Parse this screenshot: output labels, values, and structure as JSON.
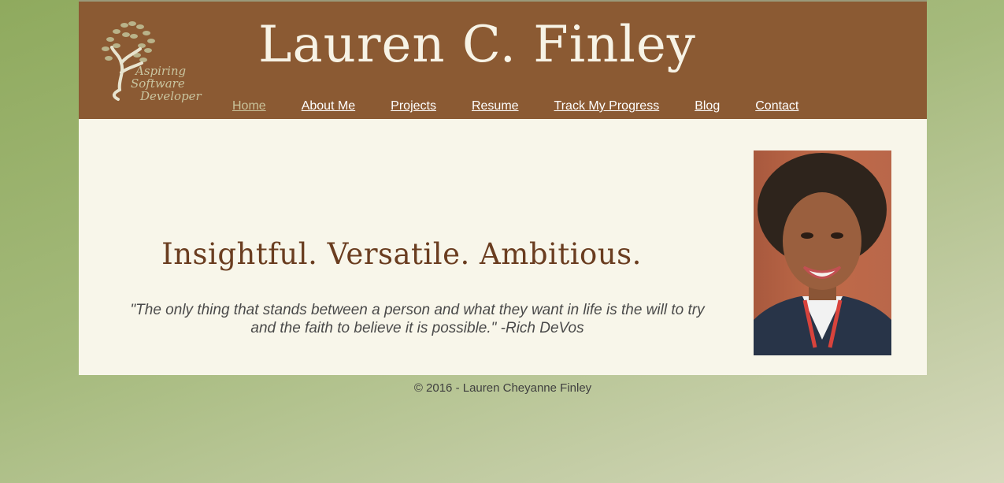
{
  "header": {
    "site_title": "Lauren C. Finley",
    "logo": {
      "line1": "Aspiring",
      "line2": "Software",
      "line3": "Developer",
      "icon": "tree-logo-icon"
    }
  },
  "nav": {
    "items": [
      {
        "label": "Home",
        "active": true
      },
      {
        "label": "About Me"
      },
      {
        "label": "Projects"
      },
      {
        "label": "Resume"
      },
      {
        "label": "Track My Progress"
      },
      {
        "label": "Blog"
      },
      {
        "label": "Contact"
      }
    ]
  },
  "main": {
    "tagline": "Insightful. Versatile. Ambitious.",
    "quote": "\"The only thing that stands between a person and what they want in life is the will to try and the faith to believe it is possible.\" -Rich DeVos"
  },
  "footer": {
    "copyright": "© 2016 - Lauren Cheyanne Finley"
  },
  "colors": {
    "header_bg": "#8b5a33",
    "content_bg": "#f8f6ea",
    "tagline": "#6a3d20",
    "nav_active": "#c9c29a"
  }
}
